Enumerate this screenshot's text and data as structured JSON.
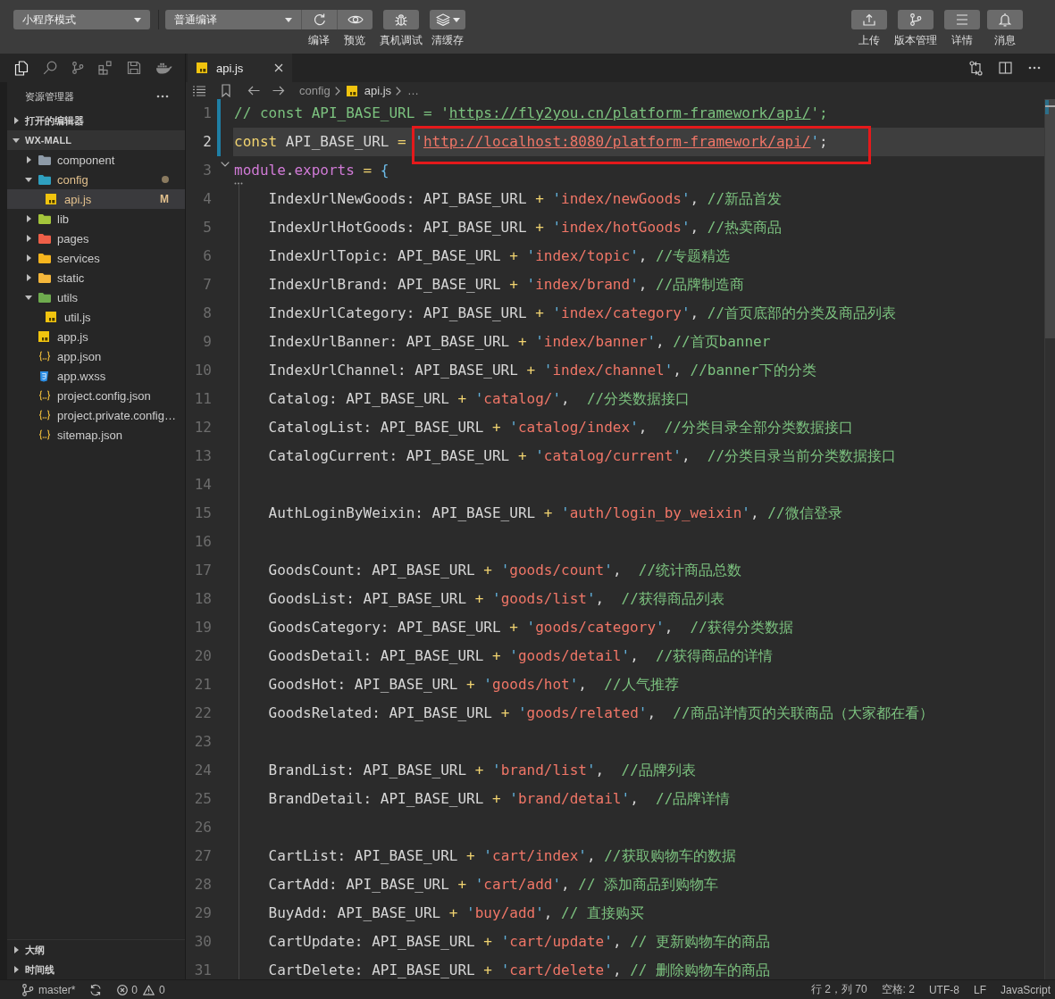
{
  "toolbar": {
    "mode_select": {
      "value": "小程序模式"
    },
    "compile_select": {
      "value": "普通编译"
    },
    "compile_actions": [
      {
        "kind": "compile",
        "label": "编译"
      },
      {
        "kind": "preview",
        "label": "预览"
      }
    ],
    "tools": [
      {
        "kind": "debug",
        "label": "真机调试"
      },
      {
        "kind": "clear-cache",
        "label": "清缓存"
      }
    ],
    "right_actions": [
      {
        "kind": "upload",
        "label": "上传"
      },
      {
        "kind": "version",
        "label": "版本管理"
      },
      {
        "kind": "details",
        "label": "详情"
      },
      {
        "kind": "messages",
        "label": "消息"
      }
    ]
  },
  "activity_bar": [
    {
      "kind": "explorer",
      "selected": true
    },
    {
      "kind": "search",
      "selected": false
    },
    {
      "kind": "source-control",
      "selected": false
    },
    {
      "kind": "extensions",
      "selected": false
    },
    {
      "kind": "storage",
      "selected": false
    },
    {
      "kind": "docker",
      "selected": false
    }
  ],
  "sidebar": {
    "title": "资源管理器",
    "sections": [
      {
        "label": "打开的编辑器",
        "expanded": false
      },
      {
        "label": "WX-MALL",
        "expanded": true,
        "tree": [
          {
            "label": "component",
            "kind": "folder",
            "color": "#8e9ba8",
            "expanded": false,
            "selected": false,
            "modified": false
          },
          {
            "label": "config",
            "kind": "folder",
            "color": "#2fa0c0",
            "expanded": true,
            "selected": false,
            "modified": true,
            "children": [
              {
                "label": "api.js",
                "kind": "js",
                "selected": true,
                "modified": true,
                "badge": "M"
              }
            ]
          },
          {
            "label": "lib",
            "kind": "folder",
            "color": "#a4c53b",
            "expanded": false,
            "selected": false,
            "modified": false
          },
          {
            "label": "pages",
            "kind": "folder",
            "color": "#ef5f48",
            "expanded": false,
            "selected": false,
            "modified": false
          },
          {
            "label": "services",
            "kind": "folder",
            "color": "#f6b51e",
            "expanded": false,
            "selected": false,
            "modified": false
          },
          {
            "label": "static",
            "kind": "folder",
            "color": "#f4b73b",
            "expanded": false,
            "selected": false,
            "modified": false
          },
          {
            "label": "utils",
            "kind": "folder",
            "color": "#6eab4e",
            "expanded": true,
            "selected": false,
            "modified": false,
            "children": [
              {
                "label": "util.js",
                "kind": "js",
                "selected": false,
                "modified": false
              }
            ]
          },
          {
            "label": "app.js",
            "kind": "js",
            "selected": false,
            "modified": false
          },
          {
            "label": "app.json",
            "kind": "json",
            "selected": false,
            "modified": false
          },
          {
            "label": "app.wxss",
            "kind": "wxss",
            "selected": false,
            "modified": false
          },
          {
            "label": "project.config.json",
            "kind": "json",
            "selected": false,
            "modified": false
          },
          {
            "label": "project.private.config…",
            "kind": "json",
            "selected": false,
            "modified": false
          },
          {
            "label": "sitemap.json",
            "kind": "json",
            "selected": false,
            "modified": false
          }
        ]
      }
    ],
    "bottom_sections": [
      {
        "label": "大纲",
        "expanded": false
      },
      {
        "label": "时间线",
        "expanded": false
      }
    ]
  },
  "editor": {
    "tabs": [
      {
        "label": "api.js",
        "kind": "js",
        "selected": true
      }
    ],
    "breadcrumb": [
      {
        "label": "config",
        "kind": "folder"
      },
      {
        "label": "api.js",
        "kind": "js"
      },
      {
        "label": "…",
        "kind": "overflow"
      }
    ],
    "lines": [
      {
        "number": "1",
        "current": false,
        "modified": true,
        "tokens": [
          {
            "kind": "comment",
            "text": "// const API_BASE_URL = '"
          },
          {
            "kind": "comment-link",
            "text": "https://fly2you.cn/platform-framework/api/"
          },
          {
            "kind": "comment",
            "text": "';"
          }
        ]
      },
      {
        "number": "2",
        "current": true,
        "modified": true,
        "tokens": [
          {
            "kind": "keyword",
            "text": "const"
          },
          {
            "kind": "plain",
            "text": " API_BASE_URL "
          },
          {
            "kind": "operator",
            "text": "= "
          },
          {
            "kind": "boxed",
            "tokens": [
              {
                "kind": "quote",
                "text": "'"
              },
              {
                "kind": "link",
                "text": "http://localhost:8080/platform-framework/api/"
              },
              {
                "kind": "quote",
                "text": "'"
              },
              {
                "kind": "plain",
                "text": ";"
              }
            ]
          }
        ]
      },
      {
        "number": "3",
        "current": false,
        "modified": false,
        "expanded": true,
        "tokens": [
          {
            "kind": "object",
            "text": "module"
          },
          {
            "kind": "plain",
            "text": "."
          },
          {
            "kind": "object",
            "text": "exports"
          },
          {
            "kind": "operator",
            "text": " = "
          },
          {
            "kind": "bracket",
            "text": "{"
          }
        ],
        "children": [
          {
            "number": "4",
            "current": false,
            "modified": false,
            "tokens": [
              {
                "kind": "plain",
                "text": "IndexUrlNewGoods: API_BASE_URL "
              },
              {
                "kind": "operator",
                "text": "+"
              },
              {
                "kind": "quote",
                "text": " '"
              },
              {
                "kind": "string",
                "text": "index/newGoods"
              },
              {
                "kind": "quote",
                "text": "'"
              },
              {
                "kind": "plain",
                "text": ", "
              },
              {
                "kind": "comment",
                "text": "//新品首发"
              }
            ]
          },
          {
            "number": "5",
            "current": false,
            "modified": false,
            "tokens": [
              {
                "kind": "plain",
                "text": "IndexUrlHotGoods: API_BASE_URL "
              },
              {
                "kind": "operator",
                "text": "+"
              },
              {
                "kind": "quote",
                "text": " '"
              },
              {
                "kind": "string",
                "text": "index/hotGoods"
              },
              {
                "kind": "quote",
                "text": "'"
              },
              {
                "kind": "plain",
                "text": ", "
              },
              {
                "kind": "comment",
                "text": "//热卖商品"
              }
            ]
          },
          {
            "number": "6",
            "current": false,
            "modified": false,
            "tokens": [
              {
                "kind": "plain",
                "text": "IndexUrlTopic: API_BASE_URL "
              },
              {
                "kind": "operator",
                "text": "+"
              },
              {
                "kind": "quote",
                "text": " '"
              },
              {
                "kind": "string",
                "text": "index/topic"
              },
              {
                "kind": "quote",
                "text": "'"
              },
              {
                "kind": "plain",
                "text": ", "
              },
              {
                "kind": "comment",
                "text": "//专题精选"
              }
            ]
          },
          {
            "number": "7",
            "current": false,
            "modified": false,
            "tokens": [
              {
                "kind": "plain",
                "text": "IndexUrlBrand: API_BASE_URL "
              },
              {
                "kind": "operator",
                "text": "+"
              },
              {
                "kind": "quote",
                "text": " '"
              },
              {
                "kind": "string",
                "text": "index/brand"
              },
              {
                "kind": "quote",
                "text": "'"
              },
              {
                "kind": "plain",
                "text": ", "
              },
              {
                "kind": "comment",
                "text": "//品牌制造商"
              }
            ]
          },
          {
            "number": "8",
            "current": false,
            "modified": false,
            "tokens": [
              {
                "kind": "plain",
                "text": "IndexUrlCategory: API_BASE_URL "
              },
              {
                "kind": "operator",
                "text": "+"
              },
              {
                "kind": "quote",
                "text": " '"
              },
              {
                "kind": "string",
                "text": "index/category"
              },
              {
                "kind": "quote",
                "text": "'"
              },
              {
                "kind": "plain",
                "text": ", "
              },
              {
                "kind": "comment",
                "text": "//首页底部的分类及商品列表"
              }
            ]
          },
          {
            "number": "9",
            "current": false,
            "modified": false,
            "tokens": [
              {
                "kind": "plain",
                "text": "IndexUrlBanner: API_BASE_URL "
              },
              {
                "kind": "operator",
                "text": "+"
              },
              {
                "kind": "quote",
                "text": " '"
              },
              {
                "kind": "string",
                "text": "index/banner"
              },
              {
                "kind": "quote",
                "text": "'"
              },
              {
                "kind": "plain",
                "text": ", "
              },
              {
                "kind": "comment",
                "text": "//首页banner"
              }
            ]
          },
          {
            "number": "10",
            "current": false,
            "modified": false,
            "tokens": [
              {
                "kind": "plain",
                "text": "IndexUrlChannel: API_BASE_URL "
              },
              {
                "kind": "operator",
                "text": "+"
              },
              {
                "kind": "quote",
                "text": " '"
              },
              {
                "kind": "string",
                "text": "index/channel"
              },
              {
                "kind": "quote",
                "text": "'"
              },
              {
                "kind": "plain",
                "text": ", "
              },
              {
                "kind": "comment",
                "text": "//banner下的分类"
              }
            ]
          },
          {
            "number": "11",
            "current": false,
            "modified": false,
            "tokens": [
              {
                "kind": "plain",
                "text": "Catalog: API_BASE_URL "
              },
              {
                "kind": "operator",
                "text": "+"
              },
              {
                "kind": "quote",
                "text": " '"
              },
              {
                "kind": "string",
                "text": "catalog/"
              },
              {
                "kind": "quote",
                "text": "'"
              },
              {
                "kind": "plain",
                "text": ",  "
              },
              {
                "kind": "comment",
                "text": "//分类数据接口"
              }
            ]
          },
          {
            "number": "12",
            "current": false,
            "modified": false,
            "tokens": [
              {
                "kind": "plain",
                "text": "CatalogList: API_BASE_URL "
              },
              {
                "kind": "operator",
                "text": "+"
              },
              {
                "kind": "quote",
                "text": " '"
              },
              {
                "kind": "string",
                "text": "catalog/index"
              },
              {
                "kind": "quote",
                "text": "'"
              },
              {
                "kind": "plain",
                "text": ",  "
              },
              {
                "kind": "comment",
                "text": "//分类目录全部分类数据接口"
              }
            ]
          },
          {
            "number": "13",
            "current": false,
            "modified": false,
            "tokens": [
              {
                "kind": "plain",
                "text": "CatalogCurrent: API_BASE_URL "
              },
              {
                "kind": "operator",
                "text": "+"
              },
              {
                "kind": "quote",
                "text": " '"
              },
              {
                "kind": "string",
                "text": "catalog/current"
              },
              {
                "kind": "quote",
                "text": "'"
              },
              {
                "kind": "plain",
                "text": ",  "
              },
              {
                "kind": "comment",
                "text": "//分类目录当前分类数据接口"
              }
            ]
          },
          {
            "number": "14",
            "current": false,
            "modified": false
          },
          {
            "number": "15",
            "current": false,
            "modified": false,
            "tokens": [
              {
                "kind": "plain",
                "text": "AuthLoginByWeixin: API_BASE_URL "
              },
              {
                "kind": "operator",
                "text": "+"
              },
              {
                "kind": "quote",
                "text": " '"
              },
              {
                "kind": "string",
                "text": "auth/login_by_weixin"
              },
              {
                "kind": "quote",
                "text": "'"
              },
              {
                "kind": "plain",
                "text": ", "
              },
              {
                "kind": "comment",
                "text": "//微信登录"
              }
            ]
          },
          {
            "number": "16",
            "current": false,
            "modified": false
          },
          {
            "number": "17",
            "current": false,
            "modified": false,
            "tokens": [
              {
                "kind": "plain",
                "text": "GoodsCount: API_BASE_URL "
              },
              {
                "kind": "operator",
                "text": "+"
              },
              {
                "kind": "quote",
                "text": " '"
              },
              {
                "kind": "string",
                "text": "goods/count"
              },
              {
                "kind": "quote",
                "text": "'"
              },
              {
                "kind": "plain",
                "text": ",  "
              },
              {
                "kind": "comment",
                "text": "//统计商品总数"
              }
            ]
          },
          {
            "number": "18",
            "current": false,
            "modified": false,
            "tokens": [
              {
                "kind": "plain",
                "text": "GoodsList: API_BASE_URL "
              },
              {
                "kind": "operator",
                "text": "+"
              },
              {
                "kind": "quote",
                "text": " '"
              },
              {
                "kind": "string",
                "text": "goods/list"
              },
              {
                "kind": "quote",
                "text": "'"
              },
              {
                "kind": "plain",
                "text": ",  "
              },
              {
                "kind": "comment",
                "text": "//获得商品列表"
              }
            ]
          },
          {
            "number": "19",
            "current": false,
            "modified": false,
            "tokens": [
              {
                "kind": "plain",
                "text": "GoodsCategory: API_BASE_URL "
              },
              {
                "kind": "operator",
                "text": "+"
              },
              {
                "kind": "quote",
                "text": " '"
              },
              {
                "kind": "string",
                "text": "goods/category"
              },
              {
                "kind": "quote",
                "text": "'"
              },
              {
                "kind": "plain",
                "text": ",  "
              },
              {
                "kind": "comment",
                "text": "//获得分类数据"
              }
            ]
          },
          {
            "number": "20",
            "current": false,
            "modified": false,
            "tokens": [
              {
                "kind": "plain",
                "text": "GoodsDetail: API_BASE_URL "
              },
              {
                "kind": "operator",
                "text": "+"
              },
              {
                "kind": "quote",
                "text": " '"
              },
              {
                "kind": "string",
                "text": "goods/detail"
              },
              {
                "kind": "quote",
                "text": "'"
              },
              {
                "kind": "plain",
                "text": ",  "
              },
              {
                "kind": "comment",
                "text": "//获得商品的详情"
              }
            ]
          },
          {
            "number": "21",
            "current": false,
            "modified": false,
            "tokens": [
              {
                "kind": "plain",
                "text": "GoodsHot: API_BASE_URL "
              },
              {
                "kind": "operator",
                "text": "+"
              },
              {
                "kind": "quote",
                "text": " '"
              },
              {
                "kind": "string",
                "text": "goods/hot"
              },
              {
                "kind": "quote",
                "text": "'"
              },
              {
                "kind": "plain",
                "text": ",  "
              },
              {
                "kind": "comment",
                "text": "//人气推荐"
              }
            ]
          },
          {
            "number": "22",
            "current": false,
            "modified": false,
            "tokens": [
              {
                "kind": "plain",
                "text": "GoodsRelated: API_BASE_URL "
              },
              {
                "kind": "operator",
                "text": "+"
              },
              {
                "kind": "quote",
                "text": " '"
              },
              {
                "kind": "string",
                "text": "goods/related"
              },
              {
                "kind": "quote",
                "text": "'"
              },
              {
                "kind": "plain",
                "text": ",  "
              },
              {
                "kind": "comment",
                "text": "//商品详情页的关联商品（大家都在看）"
              }
            ]
          },
          {
            "number": "23",
            "current": false,
            "modified": false
          },
          {
            "number": "24",
            "current": false,
            "modified": false,
            "tokens": [
              {
                "kind": "plain",
                "text": "BrandList: API_BASE_URL "
              },
              {
                "kind": "operator",
                "text": "+"
              },
              {
                "kind": "quote",
                "text": " '"
              },
              {
                "kind": "string",
                "text": "brand/list"
              },
              {
                "kind": "quote",
                "text": "'"
              },
              {
                "kind": "plain",
                "text": ",  "
              },
              {
                "kind": "comment",
                "text": "//品牌列表"
              }
            ]
          },
          {
            "number": "25",
            "current": false,
            "modified": false,
            "tokens": [
              {
                "kind": "plain",
                "text": "BrandDetail: API_BASE_URL "
              },
              {
                "kind": "operator",
                "text": "+"
              },
              {
                "kind": "quote",
                "text": " '"
              },
              {
                "kind": "string",
                "text": "brand/detail"
              },
              {
                "kind": "quote",
                "text": "'"
              },
              {
                "kind": "plain",
                "text": ",  "
              },
              {
                "kind": "comment",
                "text": "//品牌详情"
              }
            ]
          },
          {
            "number": "26",
            "current": false,
            "modified": false
          },
          {
            "number": "27",
            "current": false,
            "modified": false,
            "tokens": [
              {
                "kind": "plain",
                "text": "CartList: API_BASE_URL "
              },
              {
                "kind": "operator",
                "text": "+"
              },
              {
                "kind": "quote",
                "text": " '"
              },
              {
                "kind": "string",
                "text": "cart/index"
              },
              {
                "kind": "quote",
                "text": "'"
              },
              {
                "kind": "plain",
                "text": ", "
              },
              {
                "kind": "comment",
                "text": "//获取购物车的数据"
              }
            ]
          },
          {
            "number": "28",
            "current": false,
            "modified": false,
            "tokens": [
              {
                "kind": "plain",
                "text": "CartAdd: API_BASE_URL "
              },
              {
                "kind": "operator",
                "text": "+"
              },
              {
                "kind": "quote",
                "text": " '"
              },
              {
                "kind": "string",
                "text": "cart/add"
              },
              {
                "kind": "quote",
                "text": "'"
              },
              {
                "kind": "plain",
                "text": ", "
              },
              {
                "kind": "comment",
                "text": "// 添加商品到购物车"
              }
            ]
          },
          {
            "number": "29",
            "current": false,
            "modified": false,
            "tokens": [
              {
                "kind": "plain",
                "text": "BuyAdd: API_BASE_URL "
              },
              {
                "kind": "operator",
                "text": "+"
              },
              {
                "kind": "quote",
                "text": " '"
              },
              {
                "kind": "string",
                "text": "buy/add"
              },
              {
                "kind": "quote",
                "text": "'"
              },
              {
                "kind": "plain",
                "text": ", "
              },
              {
                "kind": "comment",
                "text": "// 直接购买"
              }
            ]
          },
          {
            "number": "30",
            "current": false,
            "modified": false,
            "tokens": [
              {
                "kind": "plain",
                "text": "CartUpdate: API_BASE_URL "
              },
              {
                "kind": "operator",
                "text": "+"
              },
              {
                "kind": "quote",
                "text": " '"
              },
              {
                "kind": "string",
                "text": "cart/update"
              },
              {
                "kind": "quote",
                "text": "'"
              },
              {
                "kind": "plain",
                "text": ", "
              },
              {
                "kind": "comment",
                "text": "// 更新购物车的商品"
              }
            ]
          },
          {
            "number": "31",
            "current": false,
            "modified": false,
            "tokens": [
              {
                "kind": "plain",
                "text": "CartDelete: API_BASE_URL "
              },
              {
                "kind": "operator",
                "text": "+"
              },
              {
                "kind": "quote",
                "text": " '"
              },
              {
                "kind": "string",
                "text": "cart/delete"
              },
              {
                "kind": "quote",
                "text": "'"
              },
              {
                "kind": "plain",
                "text": ", "
              },
              {
                "kind": "comment",
                "text": "// 删除购物车的商品"
              }
            ]
          }
        ]
      }
    ]
  },
  "status_bar": {
    "branch": "master*",
    "errors": "0",
    "warnings": "0",
    "items": [
      "行 2，列 70",
      "空格: 2",
      "UTF-8",
      "LF",
      "JavaScript"
    ]
  }
}
